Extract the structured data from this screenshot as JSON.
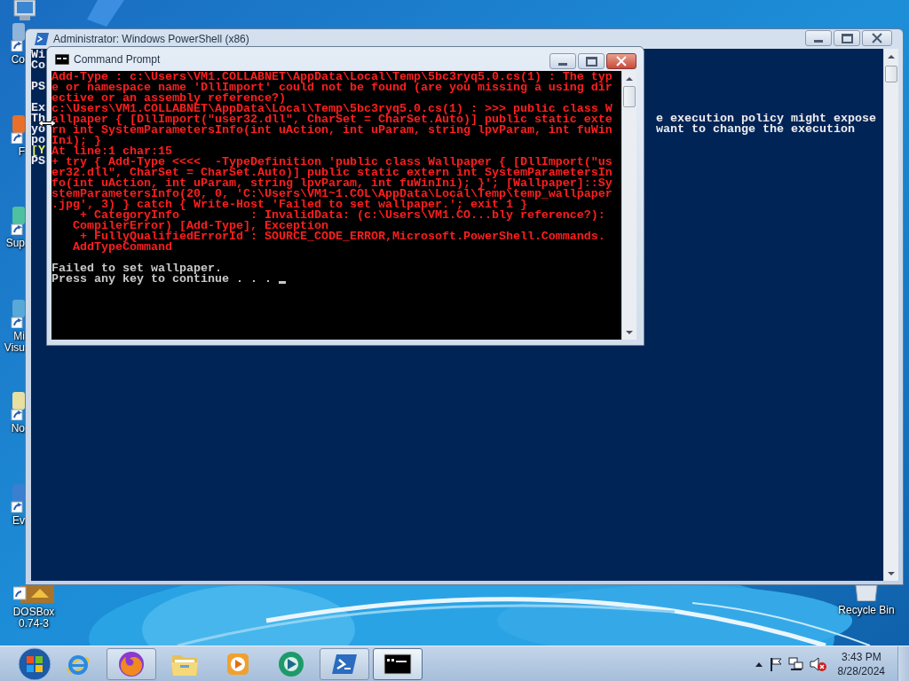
{
  "desktop": {
    "icons": [
      {
        "lines": [
          "Co"
        ]
      },
      {
        "lines": [
          "F"
        ]
      },
      {
        "lines": [
          "Sup"
        ]
      },
      {
        "lines": [
          "Mi",
          "Visu"
        ]
      },
      {
        "lines": [
          "No"
        ]
      },
      {
        "lines": [
          "Ev"
        ]
      }
    ],
    "dosbox": {
      "lines": [
        "DOSBox",
        "0.74-3"
      ]
    },
    "recycle_bin": {
      "label": "Recycle Bin"
    }
  },
  "powershell": {
    "title": "Administrator: Windows PowerShell (x86)",
    "lines": [
      {
        "kind": "text",
        "text": "Wi"
      },
      {
        "kind": "text",
        "text": "Co"
      },
      {
        "kind": "blank"
      },
      {
        "kind": "text",
        "text": "PS"
      },
      {
        "kind": "blank"
      },
      {
        "kind": "text",
        "text": "Ex"
      },
      {
        "kind": "text",
        "text": "Th",
        "right_text": "e execution policy might expose"
      },
      {
        "kind": "text",
        "text": "yo",
        "right_text": "want to change the execution"
      },
      {
        "kind": "text",
        "text": "po"
      },
      {
        "kind": "highlight",
        "text": "[Y"
      },
      {
        "kind": "text",
        "text": "PS"
      }
    ]
  },
  "command_prompt": {
    "title": "Command Prompt",
    "lines": [
      {
        "kind": "error",
        "text": "Add-Type : c:\\Users\\VM1.COLLABNET\\AppData\\Local\\Temp\\5bc3ryq5.0.cs(1) : The typ"
      },
      {
        "kind": "error",
        "text": "e or namespace name 'DllImport' could not be found (are you missing a using dir"
      },
      {
        "kind": "error",
        "text": "ective or an assembly reference?)"
      },
      {
        "kind": "error",
        "text": "c:\\Users\\VM1.COLLABNET\\AppData\\Local\\Temp\\5bc3ryq5.0.cs(1) : >>> public class W"
      },
      {
        "kind": "error",
        "text": "allpaper { [DllImport(\"user32.dll\", CharSet = CharSet.Auto)] public static exte"
      },
      {
        "kind": "error",
        "text": "rn int SystemParametersInfo(int uAction, int uParam, string lpvParam, int fuWin"
      },
      {
        "kind": "error",
        "text": "Ini); }"
      },
      {
        "kind": "error",
        "text": "At line:1 char:15"
      },
      {
        "kind": "error",
        "text": "+ try { Add-Type <<<<  -TypeDefinition 'public class Wallpaper { [DllImport(\"us"
      },
      {
        "kind": "error",
        "text": "er32.dll\", CharSet = CharSet.Auto)] public static extern int SystemParametersIn"
      },
      {
        "kind": "error",
        "text": "fo(int uAction, int uParam, string lpvParam, int fuWinIni); }'; [Wallpaper]::Sy"
      },
      {
        "kind": "error",
        "text": "stemParametersInfo(20, 0, 'C:\\Users\\VM1~1.COL\\AppData\\Local\\Temp\\temp_wallpaper"
      },
      {
        "kind": "error",
        "text": ".jpg', 3) } catch { Write-Host 'Failed to set wallpaper.'; exit 1 }"
      },
      {
        "kind": "error",
        "text": "    + CategoryInfo          : InvalidData: (c:\\Users\\VM1.CO...bly reference?):"
      },
      {
        "kind": "error",
        "text": "   CompilerError) [Add-Type], Exception"
      },
      {
        "kind": "error",
        "text": "    + FullyQualifiedErrorId : SOURCE_CODE_ERROR,Microsoft.PowerShell.Commands."
      },
      {
        "kind": "error",
        "text": "   AddTypeCommand"
      },
      {
        "kind": "blank"
      },
      {
        "kind": "output",
        "text": "Failed to set wallpaper."
      },
      {
        "kind": "output",
        "text": "Press any key to continue . . . ",
        "cursor": true
      }
    ]
  },
  "taskbar": {
    "buttons": [
      {
        "running": false,
        "selected": false
      },
      {
        "running": true,
        "selected": false
      },
      {
        "running": false,
        "selected": false
      },
      {
        "running": false,
        "selected": false
      },
      {
        "running": false,
        "selected": false
      },
      {
        "running": true,
        "selected": false
      },
      {
        "running": true,
        "selected": true
      }
    ],
    "clock": {
      "time": "3:43 PM",
      "date": "8/28/2024"
    }
  }
}
